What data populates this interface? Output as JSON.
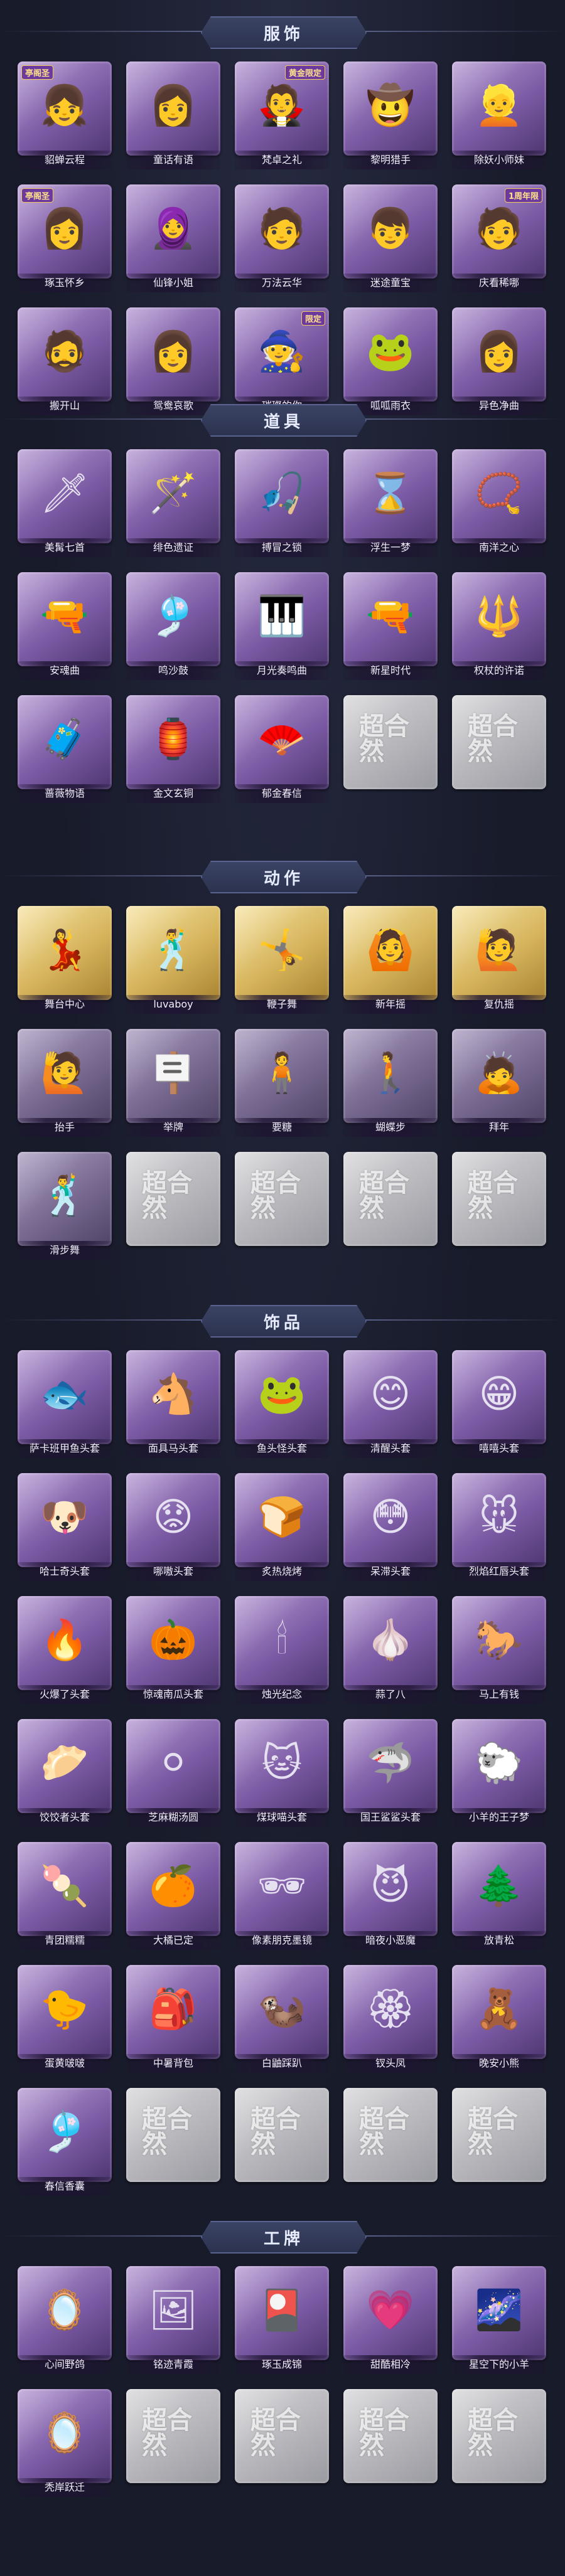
{
  "sections": [
    {
      "title": "服饰",
      "items": [
        {
          "label": "貂蝉云程",
          "icon": "girl-portrait-icon",
          "glyph": "👧",
          "tag": "亭阁圣"
        },
        {
          "label": "童话有语",
          "icon": "girl-portrait-icon",
          "glyph": "👩",
          "tag": ""
        },
        {
          "label": "梵卓之礼",
          "icon": "vampire-portrait-icon",
          "glyph": "🧛",
          "tag": "黄金限定"
        },
        {
          "label": "黎明猎手",
          "icon": "man-portrait-icon",
          "glyph": "🤠",
          "tag": ""
        },
        {
          "label": "除妖小师妹",
          "icon": "girl-portrait-icon",
          "glyph": "👱",
          "tag": ""
        },
        {
          "label": "琢玉怀乡",
          "icon": "girl-portrait-icon",
          "glyph": "👩",
          "tag": "亭阁圣"
        },
        {
          "label": "仙锋小姐",
          "icon": "girl-portrait-icon",
          "glyph": "🧕",
          "tag": ""
        },
        {
          "label": "万法云华",
          "icon": "man-portrait-icon",
          "glyph": "🧑",
          "tag": ""
        },
        {
          "label": "迷途童宝",
          "icon": "boy-portrait-icon",
          "glyph": "👦",
          "tag": ""
        },
        {
          "label": "庆看稀哪",
          "icon": "chef-portrait-icon",
          "glyph": "🧑",
          "tag": "1周年限"
        },
        {
          "label": "搬开山",
          "icon": "man-portrait-icon",
          "glyph": "🧔",
          "tag": ""
        },
        {
          "label": "鸳鸯哀歌",
          "icon": "woman-portrait-icon",
          "glyph": "👩",
          "tag": ""
        },
        {
          "label": "璀璨的你",
          "icon": "witch-portrait-icon",
          "glyph": "🧙",
          "tag": "限定"
        },
        {
          "label": "呱呱雨衣",
          "icon": "frog-portrait-icon",
          "glyph": "🐸",
          "tag": ""
        },
        {
          "label": "异色净曲",
          "icon": "woman-portrait-icon",
          "glyph": "👩",
          "tag": ""
        }
      ]
    },
    {
      "title": "道具",
      "items": [
        {
          "label": "美髯七首",
          "icon": "dagger-icon",
          "glyph": "🗡",
          "tag": ""
        },
        {
          "label": "绯色遗证",
          "icon": "staff-icon",
          "glyph": "🪄",
          "tag": ""
        },
        {
          "label": "搏冒之锁",
          "icon": "fishing-rod-icon",
          "glyph": "🎣",
          "tag": ""
        },
        {
          "label": "浮生一梦",
          "icon": "hourglass-icon",
          "glyph": "⌛",
          "tag": ""
        },
        {
          "label": "南洋之心",
          "icon": "necklace-icon",
          "glyph": "📿",
          "tag": ""
        },
        {
          "label": "安魂曲",
          "icon": "gun-icon",
          "glyph": "🔫",
          "tag": ""
        },
        {
          "label": "鸣沙鼓",
          "icon": "chime-icon",
          "glyph": "🎐",
          "tag": ""
        },
        {
          "label": "月光奏鸣曲",
          "icon": "piano-icon",
          "glyph": "🎹",
          "tag": ""
        },
        {
          "label": "新星时代",
          "icon": "revolver-icon",
          "glyph": "🔫",
          "tag": ""
        },
        {
          "label": "权杖的许诺",
          "icon": "scepter-icon",
          "glyph": "🔱",
          "tag": ""
        },
        {
          "label": "蔷薇物语",
          "icon": "suitcase-icon",
          "glyph": "🧳",
          "tag": ""
        },
        {
          "label": "金文玄铜",
          "icon": "lantern-icon",
          "glyph": "🏮",
          "tag": ""
        },
        {
          "label": "郁金春信",
          "icon": "fan-icon",
          "glyph": "🪭",
          "tag": ""
        },
        {
          "label": "超合然",
          "icon": "placeholder-logo-icon",
          "glyph": "超合然",
          "tag": "",
          "empty": true
        },
        {
          "label": "超合然",
          "icon": "placeholder-logo-icon",
          "glyph": "超合然",
          "tag": "",
          "empty": true
        }
      ]
    },
    {
      "title": "动作",
      "items": [
        {
          "label": "舞台中心",
          "icon": "dance-pose-icon",
          "glyph": "💃",
          "tag": "",
          "gold": true
        },
        {
          "label": "luvaboy",
          "icon": "dance-pose-icon",
          "glyph": "🕺",
          "tag": "",
          "gold": true
        },
        {
          "label": "鞭子舞",
          "icon": "dance-pose-icon",
          "glyph": "🤸",
          "tag": "",
          "gold": true
        },
        {
          "label": "新年摇",
          "icon": "dance-pose-icon",
          "glyph": "🙆",
          "tag": "",
          "gold": true
        },
        {
          "label": "复仇摇",
          "icon": "dance-pose-icon",
          "glyph": "🙋",
          "tag": "",
          "gold": true
        },
        {
          "label": "抬手",
          "icon": "pose-icon",
          "glyph": "🙋",
          "tag": "",
          "dim": true
        },
        {
          "label": "举牌",
          "icon": "sign-pose-icon",
          "glyph": "🪧",
          "tag": "",
          "dim": true
        },
        {
          "label": "要糖",
          "icon": "pose-icon",
          "glyph": "🧍",
          "tag": "",
          "dim": true
        },
        {
          "label": "蝴蝶步",
          "icon": "pose-icon",
          "glyph": "🚶",
          "tag": "",
          "dim": true
        },
        {
          "label": "拜年",
          "icon": "pose-icon",
          "glyph": "🙇",
          "tag": "",
          "dim": true
        },
        {
          "label": "滑步舞",
          "icon": "dance-pose-icon",
          "glyph": "🕺",
          "tag": "",
          "dim": true
        },
        {
          "label": "超合然",
          "icon": "placeholder-logo-icon",
          "glyph": "超合然",
          "tag": "",
          "empty": true
        },
        {
          "label": "超合然",
          "icon": "placeholder-logo-icon",
          "glyph": "超合然",
          "tag": "",
          "empty": true
        },
        {
          "label": "超合然",
          "icon": "placeholder-logo-icon",
          "glyph": "超合然",
          "tag": "",
          "empty": true
        },
        {
          "label": "超合然",
          "icon": "placeholder-logo-icon",
          "glyph": "超合然",
          "tag": "",
          "empty": true
        }
      ]
    },
    {
      "title": "饰品",
      "items": [
        {
          "label": "萨卡班甲鱼头套",
          "icon": "fish-head-icon",
          "glyph": "🐟",
          "tag": ""
        },
        {
          "label": "面具马头套",
          "icon": "horse-head-icon",
          "glyph": "🐴",
          "tag": ""
        },
        {
          "label": "鱼头怪头套",
          "icon": "fish-head-icon",
          "glyph": "🐸",
          "tag": ""
        },
        {
          "label": "清醒头套",
          "icon": "smiley-head-icon",
          "glyph": "😊",
          "tag": ""
        },
        {
          "label": "嘻嘻头套",
          "icon": "grin-head-icon",
          "glyph": "😁",
          "tag": ""
        },
        {
          "label": "哈士奇头套",
          "icon": "dog-head-icon",
          "glyph": "🐶",
          "tag": ""
        },
        {
          "label": "哪嗷头套",
          "icon": "worried-head-icon",
          "glyph": "😟",
          "tag": ""
        },
        {
          "label": "炙热烧烤",
          "icon": "toast-head-icon",
          "glyph": "🍞",
          "tag": ""
        },
        {
          "label": "呆滞头套",
          "icon": "stare-head-icon",
          "glyph": "😳",
          "tag": ""
        },
        {
          "label": "烈焰红唇头套",
          "icon": "pikachu-head-icon",
          "glyph": "🐭",
          "tag": ""
        },
        {
          "label": "火爆了头套",
          "icon": "fire-head-icon",
          "glyph": "🔥",
          "tag": ""
        },
        {
          "label": "惊魂南瓜头套",
          "icon": "pumpkin-head-icon",
          "glyph": "🎃",
          "tag": ""
        },
        {
          "label": "烛光纪念",
          "icon": "candle-head-icon",
          "glyph": "🕯",
          "tag": ""
        },
        {
          "label": "蒜了八",
          "icon": "garlic-head-icon",
          "glyph": "🧄",
          "tag": ""
        },
        {
          "label": "马上有钱",
          "icon": "horse-head-icon",
          "glyph": "🐎",
          "tag": ""
        },
        {
          "label": "饺饺者头套",
          "icon": "dumpling-head-icon",
          "glyph": "🥟",
          "tag": ""
        },
        {
          "label": "芝麻糊汤圆",
          "icon": "tangyuan-head-icon",
          "glyph": "⚪",
          "tag": ""
        },
        {
          "label": "煤球喵头套",
          "icon": "cat-head-icon",
          "glyph": "🐱",
          "tag": ""
        },
        {
          "label": "国王鲨鲨头套",
          "icon": "shark-head-icon",
          "glyph": "🦈",
          "tag": ""
        },
        {
          "label": "小羊的王子梦",
          "icon": "sheep-head-icon",
          "glyph": "🐑",
          "tag": ""
        },
        {
          "label": "青团糯糯",
          "icon": "green-dumpling-head-icon",
          "glyph": "🍡",
          "tag": ""
        },
        {
          "label": "大橘已定",
          "icon": "orange-head-icon",
          "glyph": "🍊",
          "tag": ""
        },
        {
          "label": "像素朋克墨镜",
          "icon": "sunglasses-icon",
          "glyph": "🕶",
          "tag": ""
        },
        {
          "label": "暗夜小恶魔",
          "icon": "devil-head-icon",
          "glyph": "😈",
          "tag": ""
        },
        {
          "label": "放青松",
          "icon": "bonsai-head-icon",
          "glyph": "🌲",
          "tag": ""
        },
        {
          "label": "蛋黄啵啵",
          "icon": "chick-head-icon",
          "glyph": "🐤",
          "tag": ""
        },
        {
          "label": "中暑背包",
          "icon": "backpack-icon",
          "glyph": "🎒",
          "tag": ""
        },
        {
          "label": "白鼬踩趴",
          "icon": "weasel-icon",
          "glyph": "🦦",
          "tag": ""
        },
        {
          "label": "钗头凤",
          "icon": "hairpin-icon",
          "glyph": "🏵",
          "tag": ""
        },
        {
          "label": "晚安小熊",
          "icon": "bear-pendant-icon",
          "glyph": "🧸",
          "tag": ""
        },
        {
          "label": "春信香囊",
          "icon": "sachet-icon",
          "glyph": "🎐",
          "tag": ""
        },
        {
          "label": "超合然",
          "icon": "placeholder-logo-icon",
          "glyph": "超合然",
          "tag": "",
          "empty": true
        },
        {
          "label": "超合然",
          "icon": "placeholder-logo-icon",
          "glyph": "超合然",
          "tag": "",
          "empty": true
        },
        {
          "label": "超合然",
          "icon": "placeholder-logo-icon",
          "glyph": "超合然",
          "tag": "",
          "empty": true
        },
        {
          "label": "超合然",
          "icon": "placeholder-logo-icon",
          "glyph": "超合然",
          "tag": "",
          "empty": true
        }
      ]
    },
    {
      "title": "工牌",
      "items": [
        {
          "label": "心间野鸽",
          "icon": "badge-card-icon",
          "glyph": "🪞",
          "tag": ""
        },
        {
          "label": "铭迹青霞",
          "icon": "badge-card-icon",
          "glyph": "🖼",
          "tag": ""
        },
        {
          "label": "琢玉成锦",
          "icon": "badge-card-icon",
          "glyph": "🎴",
          "tag": ""
        },
        {
          "label": "甜酷相冷",
          "icon": "badge-card-icon",
          "glyph": "💗",
          "tag": ""
        },
        {
          "label": "星空下的小羊",
          "icon": "badge-card-icon",
          "glyph": "🌌",
          "tag": ""
        },
        {
          "label": "秃岸跃迁",
          "icon": "badge-card-icon",
          "glyph": "🪞",
          "tag": ""
        },
        {
          "label": "超合然",
          "icon": "placeholder-logo-icon",
          "glyph": "超合然",
          "tag": "",
          "empty": true
        },
        {
          "label": "超合然",
          "icon": "placeholder-logo-icon",
          "glyph": "超合然",
          "tag": "",
          "empty": true
        },
        {
          "label": "超合然",
          "icon": "placeholder-logo-icon",
          "glyph": "超合然",
          "tag": "",
          "empty": true
        },
        {
          "label": "超合然",
          "icon": "placeholder-logo-icon",
          "glyph": "超合然",
          "tag": "",
          "empty": true
        }
      ]
    }
  ]
}
